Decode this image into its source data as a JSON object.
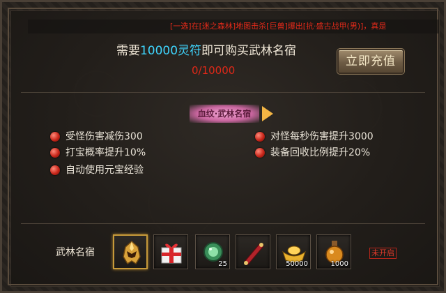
{
  "ticker": "[一选]在[迷之森林]地图击杀[巨兽]爆出[抗·盛古战甲(男)]，真是",
  "header": {
    "prefix": "需要",
    "amount": "10000灵符",
    "suffix": "即可购买武林名宿",
    "progress": "0/10000",
    "recharge_button": "立即充值"
  },
  "badge": "血纹·武林名宿",
  "attributes_left": [
    "受怪伤害减伤300",
    "打宝概率提升10%",
    "自动使用元宝经验"
  ],
  "attributes_right": [
    "对怪每秒伤害提升3000",
    "装备回收比例提升20%"
  ],
  "reward": {
    "label": "武林名宿",
    "status": "未开启",
    "items": [
      {
        "icon": "golden-helmet-icon",
        "qty": ""
      },
      {
        "icon": "gift-box-icon",
        "qty": ""
      },
      {
        "icon": "green-gem-icon",
        "qty": "25"
      },
      {
        "icon": "scroll-icon",
        "qty": ""
      },
      {
        "icon": "gold-ingot-icon",
        "qty": "50000"
      },
      {
        "icon": "potion-bottle-icon",
        "qty": "1000"
      }
    ]
  },
  "colors": {
    "highlight": "#3fd6ff",
    "danger": "#e02818",
    "bullet": "#c8261a"
  }
}
